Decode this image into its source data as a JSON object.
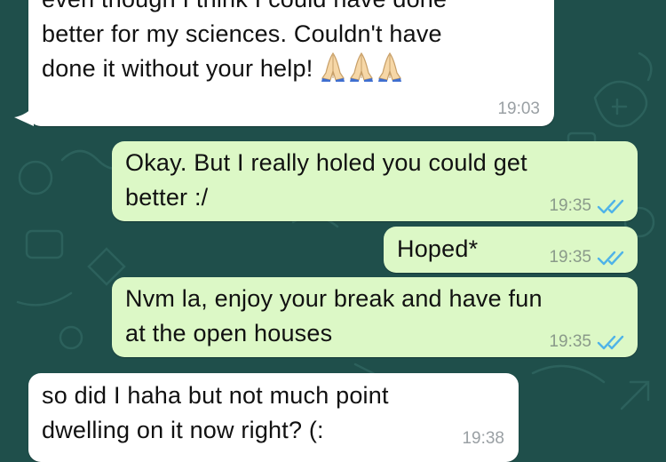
{
  "chat": {
    "messages": [
      {
        "direction": "incoming",
        "lines": [
          "even though I think I could have done",
          "better for my sciences. Couldn't have",
          "done it without your help!"
        ],
        "emoji": [
          "folded-hands",
          "folded-hands",
          "folded-hands"
        ],
        "time": "19:03"
      },
      {
        "direction": "outgoing",
        "lines": [
          "Okay. But I really holed you could get",
          "better :/"
        ],
        "time": "19:35",
        "status": "read"
      },
      {
        "direction": "outgoing",
        "lines": [
          "Hoped*"
        ],
        "time": "19:35",
        "status": "read"
      },
      {
        "direction": "outgoing",
        "lines": [
          "Nvm la, enjoy your break and have fun",
          "at the open houses"
        ],
        "time": "19:35",
        "status": "read"
      },
      {
        "direction": "incoming",
        "lines": [
          "so did I haha but not much point",
          "dwelling on it now right? (:"
        ],
        "time": "19:38"
      }
    ]
  },
  "colors": {
    "wallpaper": "#1f4f4b",
    "incoming_bubble": "#ffffff",
    "outgoing_bubble": "#dcf8c6",
    "read_ticks": "#4fb3e8"
  }
}
